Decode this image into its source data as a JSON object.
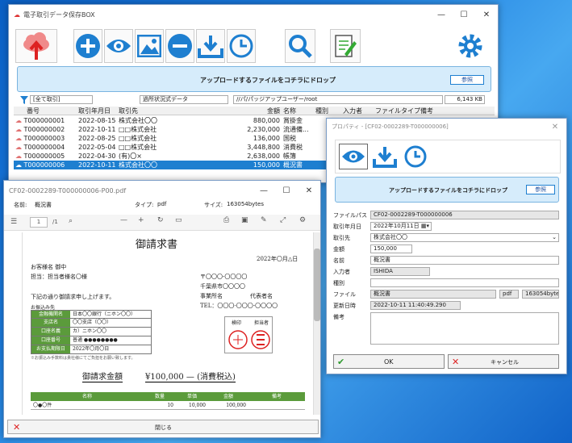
{
  "main": {
    "title": "電子取引データ保存BOX",
    "drop_text": "アップロードするファイルをコチラにドロップ",
    "ref_button": "参照",
    "filter": {
      "scope": "[全て取引]",
      "folder": "過所状況式データ",
      "path": "//パ/パッジアップユーザー/root",
      "size": "6,143 KB"
    },
    "columns": [
      "番号",
      "取引年月日",
      "取引先",
      "金額",
      "名称",
      "種別",
      "入力者",
      "ファイルタイプ",
      "備考"
    ],
    "rows": [
      {
        "no": "T000000001",
        "date": "2022-08-15",
        "party": "株式会社〇〇",
        "amount": "880,000",
        "name": "賞掛金"
      },
      {
        "no": "T000000002",
        "date": "2022-10-11",
        "party": "□□株式会社",
        "amount": "2,230,000",
        "name": "流通備..."
      },
      {
        "no": "T000000003",
        "date": "2022-08-25",
        "party": "□□株式会社",
        "amount": "136,000",
        "name": "国税"
      },
      {
        "no": "T000000004",
        "date": "2022-05-04",
        "party": "□□株式会社",
        "amount": "3,448,800",
        "name": "消費税"
      },
      {
        "no": "T000000005",
        "date": "2022-04-30",
        "party": "(有)〇×",
        "amount": "2,638,000",
        "name": "帳簿"
      },
      {
        "no": "T000000006",
        "date": "2022-10-11",
        "party": "株式会社〇〇",
        "amount": "150,000",
        "name": "概況書"
      }
    ]
  },
  "viewer": {
    "title": "CF02-0002289-T000000006-P00.pdf",
    "name_label": "名前:",
    "name_value": "概況書",
    "type_label": "タイプ:",
    "type_value": "pdf",
    "size_label": "サイズ:",
    "size_value": "163054bytes",
    "page": "1",
    "page_total": "/1",
    "close_label": "閉じる",
    "doc": {
      "heading": "御請求書",
      "date": "2022年〇月△日",
      "to1": "お客様名 御中",
      "to2": "担当：担当者様名〇様",
      "addr1": "〒〇〇〇-〇〇〇〇",
      "addr2": "千葉県市〇〇〇〇",
      "addr3": "事業所名",
      "addr4": "代表者名",
      "tel": "TEL：〇〇〇-〇〇〇-〇〇〇〇",
      "intro": "下記の通り御請求申し上げます。",
      "bank_title": "お振込み先",
      "bank": [
        [
          "金融機関名",
          "日本〇〇銀行（ニホン〇〇）"
        ],
        [
          "支店名",
          "〇〇支店（〇〇）"
        ],
        [
          "口座名義",
          "カ）ニホン〇〇"
        ],
        [
          "口座番号",
          "普通 ●●●●●●●●"
        ],
        [
          "お支払期限日",
          "2022年〇月〇日"
        ]
      ],
      "note": "※お振込み手数料は貴社様にてご負担をお願い致します。",
      "stamp1": "検印",
      "stamp2": "担当者",
      "total_label": "御請求金額",
      "total_value": "¥100,000 — (消費税込)",
      "item_cols": [
        "名称",
        "数量",
        "単価",
        "金額",
        "備考"
      ],
      "item_row": [
        "〇●〇件",
        "10",
        "10,000",
        "100,000",
        ""
      ]
    }
  },
  "props": {
    "title": "プロパティ - [CF02-0002289-T000000006]",
    "drop_text": "アップロードするファイルをコチラにドロップ",
    "ref_button": "参照",
    "fields": {
      "path_label": "ファイルパス",
      "path": "CF02-0002289-T000000006",
      "date_label": "取引年月日",
      "date": "2022年10月11日",
      "party_label": "取引先",
      "party": "株式会社〇〇",
      "amount_label": "金額",
      "amount": "150,000",
      "name_label": "名前",
      "name": "概況書",
      "user_label": "入力者",
      "user": "ISHIDA",
      "kind_label": "種別",
      "kind": "",
      "file_label": "ファイル",
      "file": "概況書",
      "ftype": "pdf",
      "fsize": "163054bytes",
      "updated_label": "更新日時",
      "updated": "2022-10-11 11:40:49.290",
      "memo_label": "備考"
    },
    "ok": "OK",
    "cancel": "キャンセル"
  },
  "colors": {
    "accent": "#1e7fd0",
    "drop": "#d6ecfb",
    "green": "#2e9a2e",
    "red": "#d22"
  }
}
